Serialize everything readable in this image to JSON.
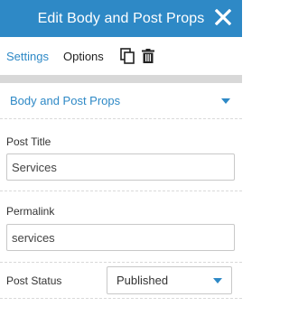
{
  "header": {
    "title": "Edit Body and Post Props",
    "close_icon": "close-icon"
  },
  "tabs": {
    "settings": "Settings",
    "options": "Options",
    "duplicate_icon": "duplicate-icon",
    "trash_icon": "trash-icon"
  },
  "section": {
    "title": "Body and Post Props",
    "toggle_icon": "caret-down-icon"
  },
  "fields": {
    "post_title": {
      "label": "Post Title",
      "value": "Services"
    },
    "permalink": {
      "label": "Permalink",
      "value": "services"
    },
    "post_status": {
      "label": "Post Status",
      "value": "Published"
    }
  },
  "colors": {
    "accent": "#2e89c6",
    "divider": "#d8d8d8"
  }
}
